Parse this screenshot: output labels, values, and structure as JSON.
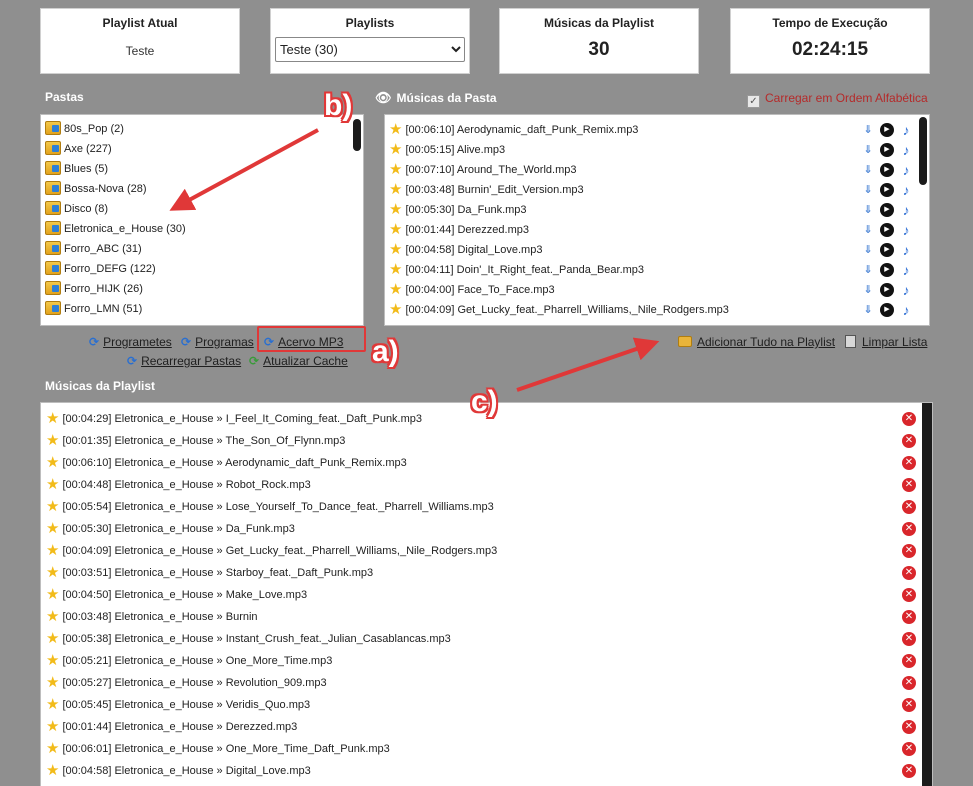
{
  "cards": {
    "current_playlist": {
      "title": "Playlist Atual",
      "value": "Teste"
    },
    "playlists": {
      "title": "Playlists",
      "selected": "Teste (30)"
    },
    "song_count": {
      "title": "Músicas da Playlist",
      "value": "30"
    },
    "runtime": {
      "title": "Tempo de Execução",
      "value": "02:24:15"
    }
  },
  "folders": {
    "title": "Pastas",
    "items": [
      "80s_Pop (2)",
      "Axe (227)",
      "Blues (5)",
      "Bossa-Nova (28)",
      "Disco (8)",
      "Eletronica_e_House (30)",
      "Forro_ABC (31)",
      "Forro_DEFG (122)",
      "Forro_HIJK (26)",
      "Forro_LMN (51)"
    ]
  },
  "folder_songs": {
    "title": "Músicas da Pasta",
    "alpha_label": "Carregar em Ordem Alfabética",
    "items": [
      "[00:06:10] Aerodynamic_daft_Punk_Remix.mp3",
      "[00:05:15] Alive.mp3",
      "[00:07:10] Around_The_World.mp3",
      "[00:03:48] Burnin'_Edit_Version.mp3",
      "[00:05:30] Da_Funk.mp3",
      "[00:01:44] Derezzed.mp3",
      "[00:04:58] Digital_Love.mp3",
      "[00:04:11] Doin'_It_Right_feat._Panda_Bear.mp3",
      "[00:04:00] Face_To_Face.mp3",
      "[00:04:09] Get_Lucky_feat._Pharrell_Williams,_Nile_Rodgers.mp3"
    ]
  },
  "links": {
    "programetes": "Programetes",
    "programas": "Programas",
    "acervo": "Acervo MP3",
    "recarregar": "Recarregar Pastas",
    "atualizar": "Atualizar Cache",
    "adicionar": "Adicionar Tudo na Playlist",
    "limpar": "Limpar Lista"
  },
  "playlist": {
    "title": "Músicas da Playlist",
    "items": [
      "[00:04:29] Eletronica_e_House » I_Feel_It_Coming_feat._Daft_Punk.mp3",
      "[00:01:35] Eletronica_e_House » The_Son_Of_Flynn.mp3",
      "[00:06:10] Eletronica_e_House » Aerodynamic_daft_Punk_Remix.mp3",
      "[00:04:48] Eletronica_e_House » Robot_Rock.mp3",
      "[00:05:54] Eletronica_e_House » Lose_Yourself_To_Dance_feat._Pharrell_Williams.mp3",
      "[00:05:30] Eletronica_e_House » Da_Funk.mp3",
      "[00:04:09] Eletronica_e_House » Get_Lucky_feat._Pharrell_Williams,_Nile_Rodgers.mp3",
      "[00:03:51] Eletronica_e_House » Starboy_feat._Daft_Punk.mp3",
      "[00:04:50] Eletronica_e_House » Make_Love.mp3",
      "[00:03:48] Eletronica_e_House » Burnin",
      "[00:05:38] Eletronica_e_House » Instant_Crush_feat._Julian_Casablancas.mp3",
      "[00:05:21] Eletronica_e_House » One_More_Time.mp3",
      "[00:05:27] Eletronica_e_House » Revolution_909.mp3",
      "[00:05:45] Eletronica_e_House » Veridis_Quo.mp3",
      "[00:01:44] Eletronica_e_House » Derezzed.mp3",
      "[00:06:01] Eletronica_e_House » One_More_Time_Daft_Punk.mp3",
      "[00:04:58] Eletronica_e_House » Digital_Love.mp3"
    ]
  },
  "annotations": {
    "a": "a)",
    "b": "b)",
    "c": "c)"
  },
  "colors": {
    "background": "#8f8f8f",
    "annotation": "#e03838",
    "alpha_label": "#b52a2a",
    "star": "#f2bb1a",
    "delete": "#d9262b"
  }
}
